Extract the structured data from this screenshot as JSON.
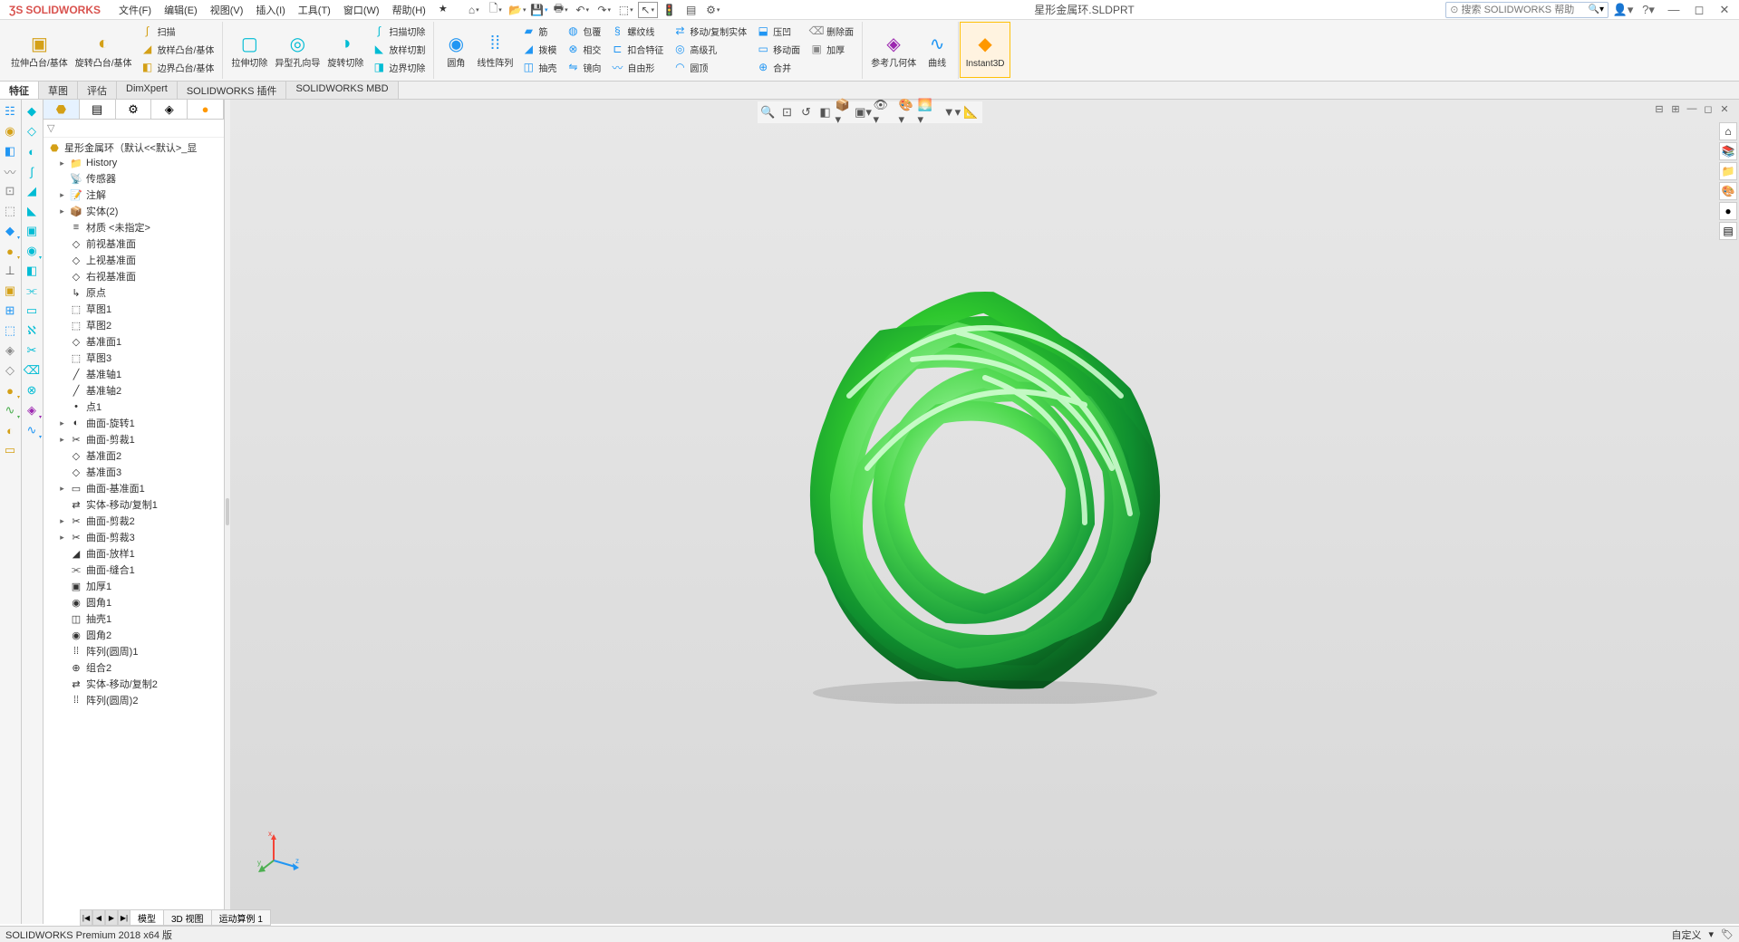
{
  "app": {
    "logo": "SOLIDWORKS",
    "title": "星形金属环.SLDPRT"
  },
  "menu": [
    "文件(F)",
    "编辑(E)",
    "视图(V)",
    "插入(I)",
    "工具(T)",
    "窗口(W)",
    "帮助(H)"
  ],
  "search": {
    "placeholder": "搜索 SOLIDWORKS 帮助"
  },
  "ribbon": {
    "extrude": "拉伸凸台/基体",
    "revolve": "旋转凸台/基体",
    "sweep": "扫描",
    "loft": "放样凸台/基体",
    "boundary": "边界凸台/基体",
    "excut": "拉伸切除",
    "hole": "异型孔向导",
    "revcut": "旋转切除",
    "sweepcut": "扫描切除",
    "loftcut": "放样切割",
    "boundcut": "边界切除",
    "fillet": "圆角",
    "pattern": "线性阵列",
    "rib": "筋",
    "draft": "拨模",
    "shell": "抽壳",
    "wrap": "包覆",
    "intersect": "相交",
    "mirror": "镜向",
    "helix": "螺纹线",
    "snap": "扣合特征",
    "freeform": "自由形",
    "move": "移动/复制实体",
    "moveface": "移动面",
    "advhole": "高级孔",
    "dome": "圆顶",
    "combine": "合并",
    "depress": "压凹",
    "defeat": "删除面",
    "thicken": "加厚",
    "refgeo": "参考几何体",
    "curves": "曲线",
    "instant3d": "Instant3D"
  },
  "tabs": [
    "特征",
    "草图",
    "评估",
    "DimXpert",
    "SOLIDWORKS 插件",
    "SOLIDWORKS MBD"
  ],
  "tree": {
    "root": "星形金属环（默认<<默认>_显",
    "items": [
      {
        "icon": "📁",
        "label": "History",
        "exp": "▸"
      },
      {
        "icon": "📡",
        "label": "传感器"
      },
      {
        "icon": "📝",
        "label": "注解",
        "exp": "▸"
      },
      {
        "icon": "📦",
        "label": "实体(2)",
        "exp": "▸"
      },
      {
        "icon": "≡",
        "label": "材质 <未指定>"
      },
      {
        "icon": "◇",
        "label": "前视基准面"
      },
      {
        "icon": "◇",
        "label": "上视基准面"
      },
      {
        "icon": "◇",
        "label": "右视基准面"
      },
      {
        "icon": "↳",
        "label": "原点"
      },
      {
        "icon": "⬚",
        "label": "草图1"
      },
      {
        "icon": "⬚",
        "label": "草图2"
      },
      {
        "icon": "◇",
        "label": "基准面1"
      },
      {
        "icon": "⬚",
        "label": "草图3"
      },
      {
        "icon": "╱",
        "label": "基准轴1"
      },
      {
        "icon": "╱",
        "label": "基准轴2"
      },
      {
        "icon": "•",
        "label": "点1"
      },
      {
        "icon": "◐",
        "label": "曲面-旋转1",
        "exp": "▸"
      },
      {
        "icon": "✂",
        "label": "曲面-剪裁1",
        "exp": "▸"
      },
      {
        "icon": "◇",
        "label": "基准面2"
      },
      {
        "icon": "◇",
        "label": "基准面3"
      },
      {
        "icon": "▭",
        "label": "曲面-基准面1",
        "exp": "▸"
      },
      {
        "icon": "⇄",
        "label": "实体-移动/复制1"
      },
      {
        "icon": "✂",
        "label": "曲面-剪裁2",
        "exp": "▸"
      },
      {
        "icon": "✂",
        "label": "曲面-剪裁3",
        "exp": "▸"
      },
      {
        "icon": "◢",
        "label": "曲面-放样1"
      },
      {
        "icon": "⫘",
        "label": "曲面-缝合1"
      },
      {
        "icon": "▣",
        "label": "加厚1"
      },
      {
        "icon": "◉",
        "label": "圆角1"
      },
      {
        "icon": "◫",
        "label": "抽壳1"
      },
      {
        "icon": "◉",
        "label": "圆角2"
      },
      {
        "icon": "⁞⁞",
        "label": "阵列(圆周)1"
      },
      {
        "icon": "⊕",
        "label": "组合2"
      },
      {
        "icon": "⇄",
        "label": "实体-移动/复制2"
      },
      {
        "icon": "⁞⁞",
        "label": "阵列(圆周)2"
      }
    ]
  },
  "bottomTabs": [
    "模型",
    "3D 视图",
    "运动算例 1"
  ],
  "status": {
    "left": "SOLIDWORKS Premium 2018 x64 版",
    "right": "自定义"
  }
}
